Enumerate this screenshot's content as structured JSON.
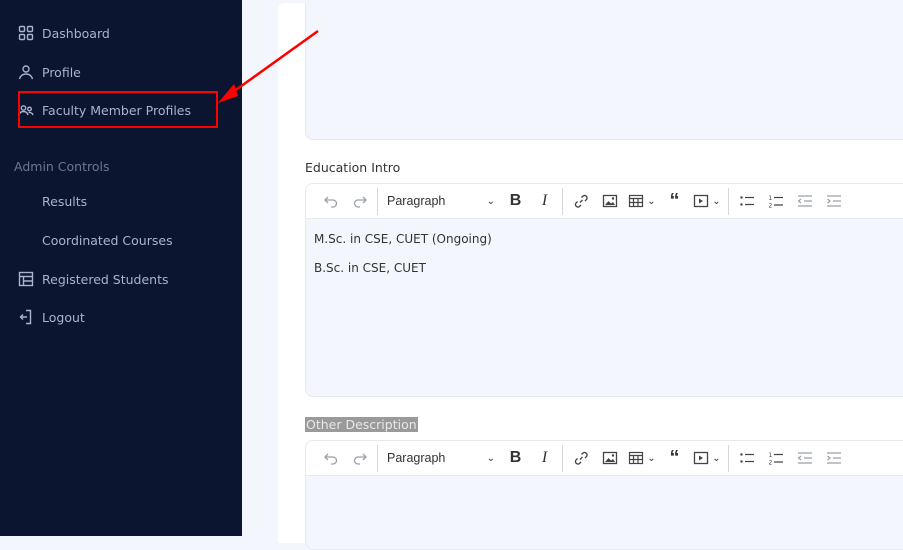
{
  "sidebar": {
    "items": [
      {
        "label": "Dashboard",
        "icon": "grid-icon"
      },
      {
        "label": "Profile",
        "icon": "user-icon"
      },
      {
        "label": "Faculty Member Profiles",
        "icon": "users-icon"
      }
    ],
    "section_label": "Admin Controls",
    "admin_items": [
      {
        "label": "Results"
      },
      {
        "label": "Coordinated Courses"
      },
      {
        "label": "Registered Students",
        "icon": "table-icon"
      },
      {
        "label": "Logout",
        "icon": "logout-icon"
      }
    ]
  },
  "annotation": {
    "color": "#ff0000",
    "target": "Faculty Member Profiles"
  },
  "editors": [
    {
      "label": "Education Intro",
      "block_format": "Paragraph",
      "content": [
        "M.Sc. in CSE, CUET (Ongoing)",
        "B.Sc. in CSE, CUET"
      ]
    },
    {
      "label": "Other Description",
      "label_selected": true,
      "block_format": "Paragraph",
      "content": []
    }
  ],
  "toolbar": {
    "icons": [
      "undo-icon",
      "redo-icon",
      "bold-icon",
      "italic-icon",
      "link-icon",
      "image-icon",
      "table-icon",
      "blockquote-icon",
      "media-icon",
      "bulleted-list-icon",
      "numbered-list-icon",
      "outdent-icon",
      "indent-icon"
    ]
  },
  "colors": {
    "sidebar_bg": "#0c1530",
    "page_bg": "#f3f6fd"
  }
}
